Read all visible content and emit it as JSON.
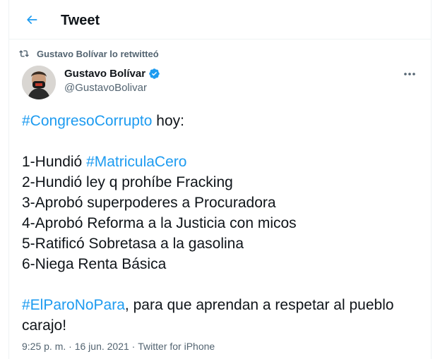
{
  "header": {
    "title": "Tweet"
  },
  "retweet": {
    "label": "Gustavo Bolívar lo retwitteó"
  },
  "author": {
    "display_name": "Gustavo Bolívar",
    "handle": "@GustavoBolivar",
    "verified": true
  },
  "tweet": {
    "line1": {
      "hashtag": "#CongresoCorrupto",
      "text": " hoy:"
    },
    "items": [
      {
        "prefix": "1-Hundió ",
        "hashtag": "#MatriculaCero"
      },
      {
        "text": "2-Hundió ley q prohíbe Fracking"
      },
      {
        "text": "3-Aprobó superpoderes a Procuradora"
      },
      {
        "text": "4-Aprobó Reforma a la Justicia con micos"
      },
      {
        "text": "5-Ratificó Sobretasa a la gasolina"
      },
      {
        "text": "6-Niega Renta Básica"
      }
    ],
    "closing": {
      "hashtag": "#ElParoNoPara",
      "text1": ", para que aprendan a respetar al pueblo",
      "text2": "carajo!"
    }
  },
  "meta": {
    "time": "9:25 p. m.",
    "sep1": " · ",
    "date": "16 jun. 2021",
    "sep2": " · ",
    "source": "Twitter for iPhone"
  },
  "colors": {
    "accent": "#1d9bf0",
    "text": "#0f1419",
    "muted": "#536471",
    "border": "#eff3f4"
  }
}
